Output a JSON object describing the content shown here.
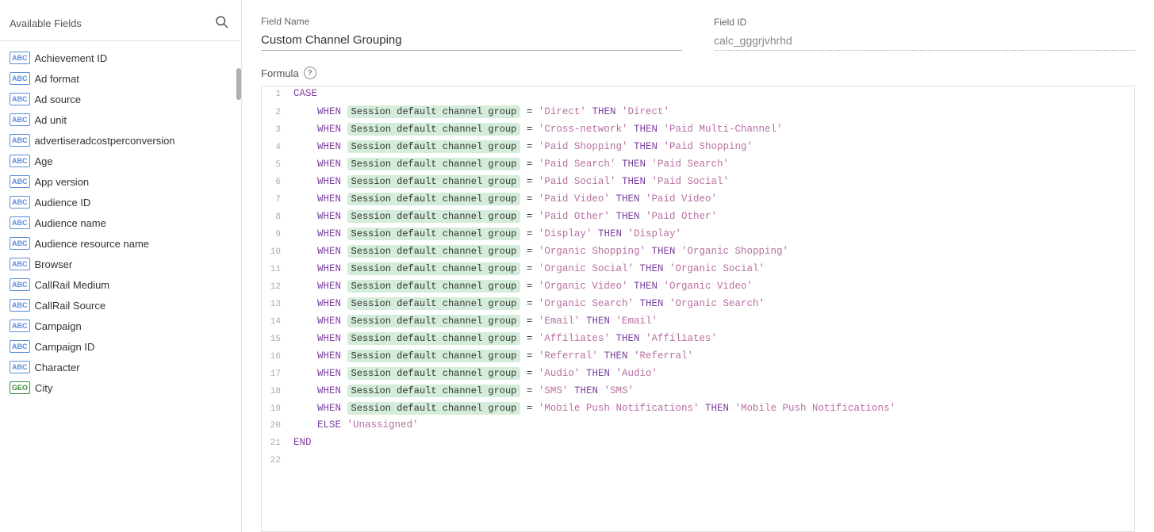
{
  "sidebar": {
    "title": "Available Fields",
    "search_placeholder": "Search fields",
    "fields": [
      {
        "label": "Achievement ID",
        "type": "ABC"
      },
      {
        "label": "Ad format",
        "type": "ABC"
      },
      {
        "label": "Ad source",
        "type": "ABC"
      },
      {
        "label": "Ad unit",
        "type": "ABC"
      },
      {
        "label": "advertiseradcostperconversion",
        "type": "ABC"
      },
      {
        "label": "Age",
        "type": "ABC"
      },
      {
        "label": "App version",
        "type": "ABC"
      },
      {
        "label": "Audience ID",
        "type": "ABC"
      },
      {
        "label": "Audience name",
        "type": "ABC"
      },
      {
        "label": "Audience resource name",
        "type": "ABC"
      },
      {
        "label": "Browser",
        "type": "ABC"
      },
      {
        "label": "CallRail Medium",
        "type": "ABC"
      },
      {
        "label": "CallRail Source",
        "type": "ABC"
      },
      {
        "label": "Campaign",
        "type": "ABC"
      },
      {
        "label": "Campaign ID",
        "type": "ABC"
      },
      {
        "label": "Character",
        "type": "ABC"
      },
      {
        "label": "City",
        "type": "GEO"
      }
    ]
  },
  "header": {
    "field_name_label": "Field Name",
    "field_name_value": "Custom Channel Grouping",
    "field_id_label": "Field ID",
    "field_id_value": "calc_gggrjvhrhd"
  },
  "formula": {
    "label": "Formula",
    "chip_label": "Session default channel group",
    "lines": [
      {
        "num": 1,
        "type": "case"
      },
      {
        "num": 2,
        "type": "when",
        "condition": "'Direct'",
        "result": "'Direct'"
      },
      {
        "num": 3,
        "type": "when",
        "condition": "'Cross-network'",
        "result": "'Paid Multi-Channel'"
      },
      {
        "num": 4,
        "type": "when",
        "condition": "'Paid Shopping'",
        "result": "'Paid Shopping'"
      },
      {
        "num": 5,
        "type": "when",
        "condition": "'Paid Search'",
        "result": "'Paid Search'"
      },
      {
        "num": 6,
        "type": "when",
        "condition": "'Paid Social'",
        "result": "'Paid Social'"
      },
      {
        "num": 7,
        "type": "when",
        "condition": "'Paid Video'",
        "result": "'Paid Video'"
      },
      {
        "num": 8,
        "type": "when",
        "condition": "'Paid Other'",
        "result": "'Paid Other'"
      },
      {
        "num": 9,
        "type": "when",
        "condition": "'Display'",
        "result": "'Display'"
      },
      {
        "num": 10,
        "type": "when",
        "condition": "'Organic Shopping'",
        "result": "'Organic Shopping'"
      },
      {
        "num": 11,
        "type": "when",
        "condition": "'Organic Social'",
        "result": "'Organic Social'"
      },
      {
        "num": 12,
        "type": "when",
        "condition": "'Organic Video'",
        "result": "'Organic Video'"
      },
      {
        "num": 13,
        "type": "when",
        "condition": "'Organic Search'",
        "result": "'Organic Search'"
      },
      {
        "num": 14,
        "type": "when",
        "condition": "'Email'",
        "result": "'Email'"
      },
      {
        "num": 15,
        "type": "when",
        "condition": "'Affiliates'",
        "result": "'Affiliates'"
      },
      {
        "num": 16,
        "type": "when",
        "condition": "'Referral'",
        "result": "'Referral'"
      },
      {
        "num": 17,
        "type": "when",
        "condition": "'Audio'",
        "result": "'Audio'"
      },
      {
        "num": 18,
        "type": "when",
        "condition": "'SMS'",
        "result": "'SMS'"
      },
      {
        "num": 19,
        "type": "when",
        "condition": "'Mobile Push Notifications'",
        "result": "'Mobile Push Notifications'"
      },
      {
        "num": 20,
        "type": "else",
        "result": "'Unassigned'"
      },
      {
        "num": 21,
        "type": "end"
      },
      {
        "num": 22,
        "type": "empty"
      }
    ]
  }
}
